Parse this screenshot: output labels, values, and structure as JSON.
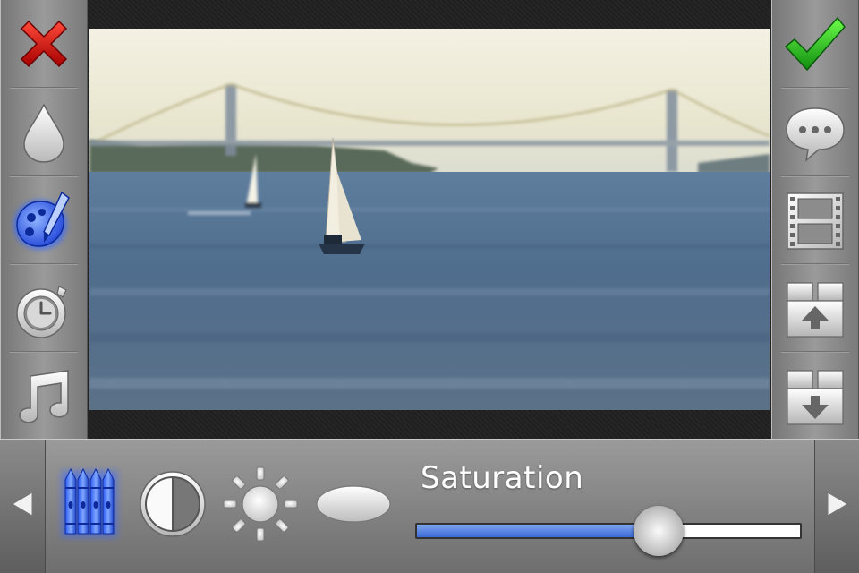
{
  "app": {
    "left_toolbar": [
      {
        "name": "cancel",
        "icon": "close-icon",
        "color": "#d91a1a"
      },
      {
        "name": "color",
        "icon": "water-drop-icon"
      },
      {
        "name": "effects",
        "icon": "palette-brush-icon",
        "selected": true,
        "color": "#3a6bff"
      },
      {
        "name": "timer",
        "icon": "stopwatch-icon"
      },
      {
        "name": "music",
        "icon": "music-note-icon"
      }
    ],
    "right_toolbar": [
      {
        "name": "confirm",
        "icon": "checkmark-icon",
        "color": "#1fbf1f"
      },
      {
        "name": "caption",
        "icon": "speech-bubble-icon"
      },
      {
        "name": "film",
        "icon": "film-strip-icon"
      },
      {
        "name": "export",
        "icon": "box-up-icon"
      },
      {
        "name": "import",
        "icon": "box-down-icon"
      }
    ],
    "bottom_tools": [
      {
        "name": "saturation",
        "icon": "crayons-icon",
        "selected": true
      },
      {
        "name": "contrast",
        "icon": "contrast-circle-icon"
      },
      {
        "name": "brightness",
        "icon": "sun-icon"
      },
      {
        "name": "vignette",
        "icon": "ellipse-icon"
      }
    ],
    "adjustment": {
      "label": "Saturation",
      "value_fraction": 0.63,
      "fill_color": "#3a6ad6"
    }
  }
}
